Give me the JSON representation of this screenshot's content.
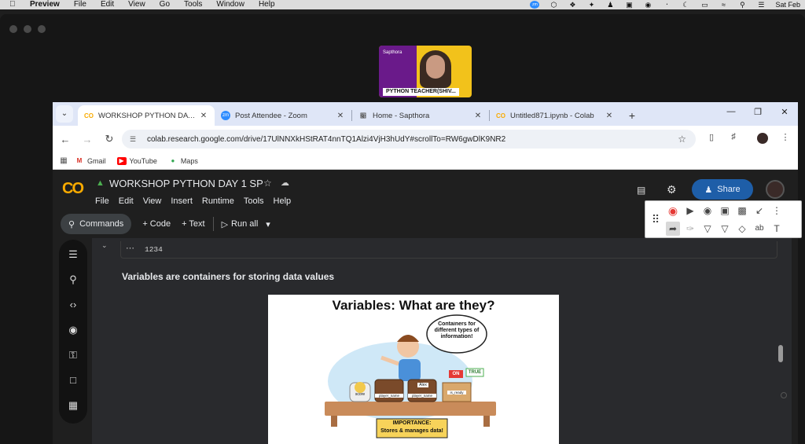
{
  "menubar": {
    "items": [
      "Preview",
      "File",
      "Edit",
      "View",
      "Go",
      "Tools",
      "Window",
      "Help"
    ],
    "clock": "Sat Feb"
  },
  "video": {
    "brand": "Sapthora",
    "name": "PYTHON TEACHER(SHIV..."
  },
  "tabs": [
    {
      "title": "WORKSHOP PYTHON DAY 1 SP",
      "favicon": "colab-icon",
      "active": true
    },
    {
      "title": "Post Attendee - Zoom",
      "favicon": "zoom-icon",
      "active": false
    },
    {
      "title": "Home - Sapthora",
      "favicon": "sapthora-icon",
      "active": false
    },
    {
      "title": "Untitled871.ipynb - Colab",
      "favicon": "colab-icon",
      "active": false
    }
  ],
  "address": {
    "url": "colab.research.google.com/drive/17UlNNXkHStRAT4nnTQ1Alzi4VjH3hUdY#scrollTo=RW6gwDlK9NR2"
  },
  "bookmarks": [
    "Gmail",
    "YouTube",
    "Maps"
  ],
  "colab": {
    "doc_title": "WORKSHOP PYTHON DAY 1 SP",
    "menu": [
      "File",
      "Edit",
      "View",
      "Insert",
      "Runtime",
      "Tools",
      "Help"
    ],
    "share_label": "Share",
    "commands_label": "Commands",
    "code_label": "+ Code",
    "text_label": "+ Text",
    "run_all_label": "Run all"
  },
  "notebook": {
    "cell_output": "1234",
    "markdown_text": "Variables are containers for storing data values",
    "slide": {
      "title": "Variables: What are they?",
      "bubble": "Containers for different types of information!",
      "on_label": "ON",
      "true_label": "TRUE",
      "jar_label": "score",
      "chest1_label": "player_name",
      "chest2_label": "player_name",
      "alex_label": "Alex",
      "box_label": "is_ready",
      "importance_title": "IMPORTANCE:",
      "importance_text": "Stores & manages data!"
    }
  },
  "colors": {
    "colab_orange": "#f9ab00",
    "share_blue": "#1e5ea8",
    "record_red": "#e53935"
  }
}
